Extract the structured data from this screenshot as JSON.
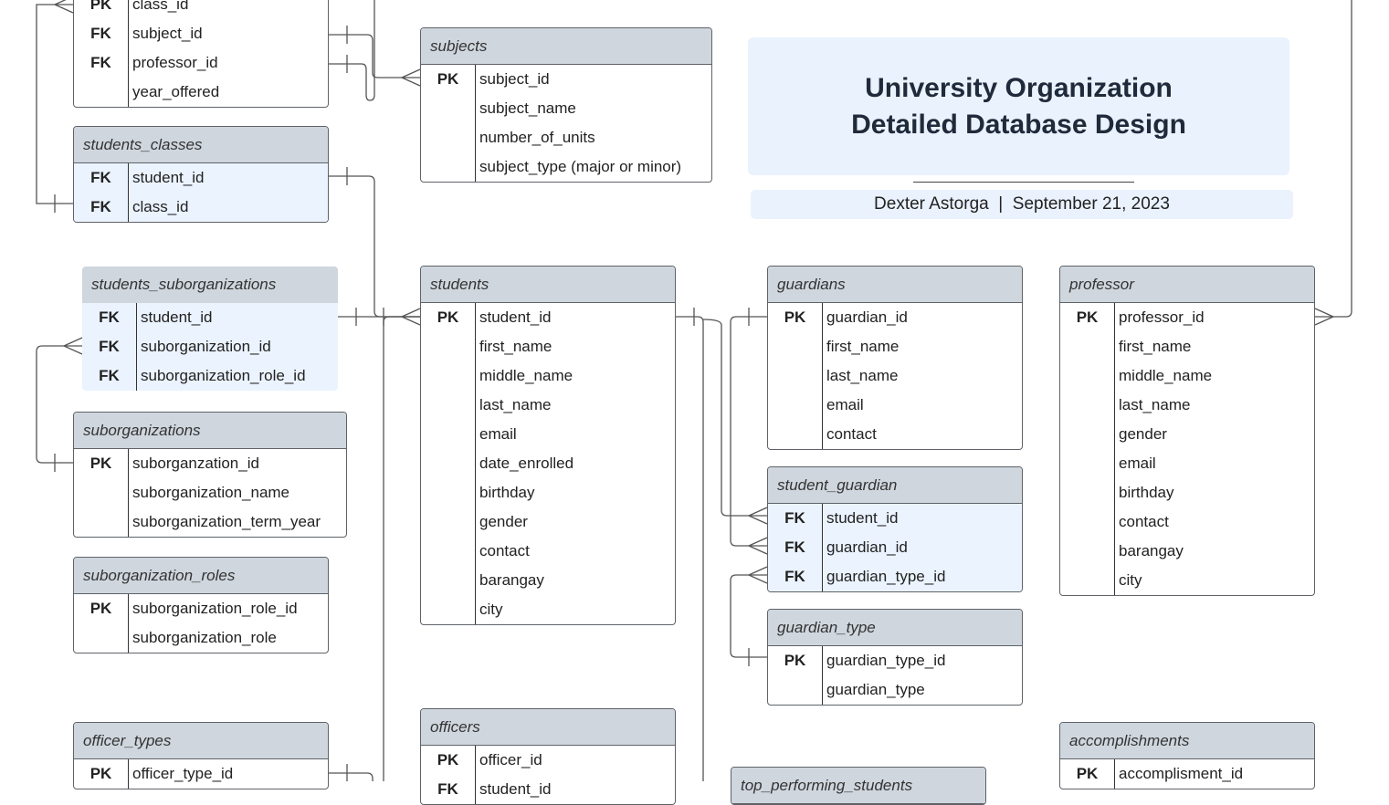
{
  "title": {
    "line1": "University Organization",
    "line2": "Detailed Database Design"
  },
  "subtitle": {
    "author": "Dexter Astorga",
    "separator": "|",
    "date": "September 21, 2023"
  },
  "tables": [
    {
      "name": "",
      "light": false,
      "rows": [
        {
          "key": "PK",
          "field": "class_id"
        },
        {
          "key": "FK",
          "field": "subject_id"
        },
        {
          "key": "FK",
          "field": "professor_id"
        },
        {
          "key": "",
          "field": "year_offered"
        }
      ]
    },
    {
      "name": "students_classes",
      "light": true,
      "rows": [
        {
          "key": "FK",
          "field": "student_id"
        },
        {
          "key": "FK",
          "field": "class_id"
        }
      ]
    },
    {
      "name": "subjects",
      "light": false,
      "rows": [
        {
          "key": "PK",
          "field": "subject_id"
        },
        {
          "key": "",
          "field": "subject_name"
        },
        {
          "key": "",
          "field": "number_of_units"
        },
        {
          "key": "",
          "field": "subject_type (major or minor)"
        }
      ]
    },
    {
      "name": "students_suborganizations",
      "light": true,
      "rows": [
        {
          "key": "FK",
          "field": "student_id"
        },
        {
          "key": "FK",
          "field": "suborganization_id"
        },
        {
          "key": "FK",
          "field": "suborganization_role_id"
        }
      ]
    },
    {
      "name": "students",
      "light": false,
      "rows": [
        {
          "key": "PK",
          "field": "student_id"
        },
        {
          "key": "",
          "field": "first_name"
        },
        {
          "key": "",
          "field": "middle_name"
        },
        {
          "key": "",
          "field": "last_name"
        },
        {
          "key": "",
          "field": "email"
        },
        {
          "key": "",
          "field": "date_enrolled"
        },
        {
          "key": "",
          "field": "birthday"
        },
        {
          "key": "",
          "field": "gender"
        },
        {
          "key": "",
          "field": "contact"
        },
        {
          "key": "",
          "field": "barangay"
        },
        {
          "key": "",
          "field": "city"
        }
      ]
    },
    {
      "name": "guardians",
      "light": false,
      "rows": [
        {
          "key": "PK",
          "field": "guardian_id"
        },
        {
          "key": "",
          "field": "first_name"
        },
        {
          "key": "",
          "field": "last_name"
        },
        {
          "key": "",
          "field": "email"
        },
        {
          "key": "",
          "field": "contact"
        }
      ]
    },
    {
      "name": "professor",
      "light": false,
      "rows": [
        {
          "key": "PK",
          "field": "professor_id"
        },
        {
          "key": "",
          "field": "first_name"
        },
        {
          "key": "",
          "field": "middle_name"
        },
        {
          "key": "",
          "field": "last_name"
        },
        {
          "key": "",
          "field": "gender"
        },
        {
          "key": "",
          "field": "email"
        },
        {
          "key": "",
          "field": "birthday"
        },
        {
          "key": "",
          "field": "contact"
        },
        {
          "key": "",
          "field": "barangay"
        },
        {
          "key": "",
          "field": "city"
        }
      ]
    },
    {
      "name": "suborganizations",
      "light": false,
      "rows": [
        {
          "key": "PK",
          "field": "suborganzation_id"
        },
        {
          "key": "",
          "field": "suborganization_name"
        },
        {
          "key": "",
          "field": "suborganization_term_year"
        }
      ]
    },
    {
      "name": "suborganization_roles",
      "light": false,
      "rows": [
        {
          "key": "PK",
          "field": "suborganization_role_id"
        },
        {
          "key": "",
          "field": "suborganization_role"
        }
      ]
    },
    {
      "name": "student_guardian",
      "light": true,
      "rows": [
        {
          "key": "FK",
          "field": "student_id"
        },
        {
          "key": "FK",
          "field": "guardian_id"
        },
        {
          "key": "FK",
          "field": "guardian_type_id"
        }
      ]
    },
    {
      "name": "guardian_type",
      "light": false,
      "rows": [
        {
          "key": "PK",
          "field": "guardian_type_id"
        },
        {
          "key": "",
          "field": "guardian_type"
        }
      ]
    },
    {
      "name": "officer_types",
      "light": false,
      "rows": [
        {
          "key": "PK",
          "field": "officer_type_id"
        }
      ]
    },
    {
      "name": "officers",
      "light": false,
      "rows": [
        {
          "key": "PK",
          "field": "officer_id"
        },
        {
          "key": "FK",
          "field": "student_id"
        }
      ]
    },
    {
      "name": "top_performing_students",
      "light": false,
      "rows": []
    },
    {
      "name": "accomplishments",
      "light": false,
      "rows": [
        {
          "key": "PK",
          "field": "accomplisment_id"
        }
      ]
    }
  ]
}
